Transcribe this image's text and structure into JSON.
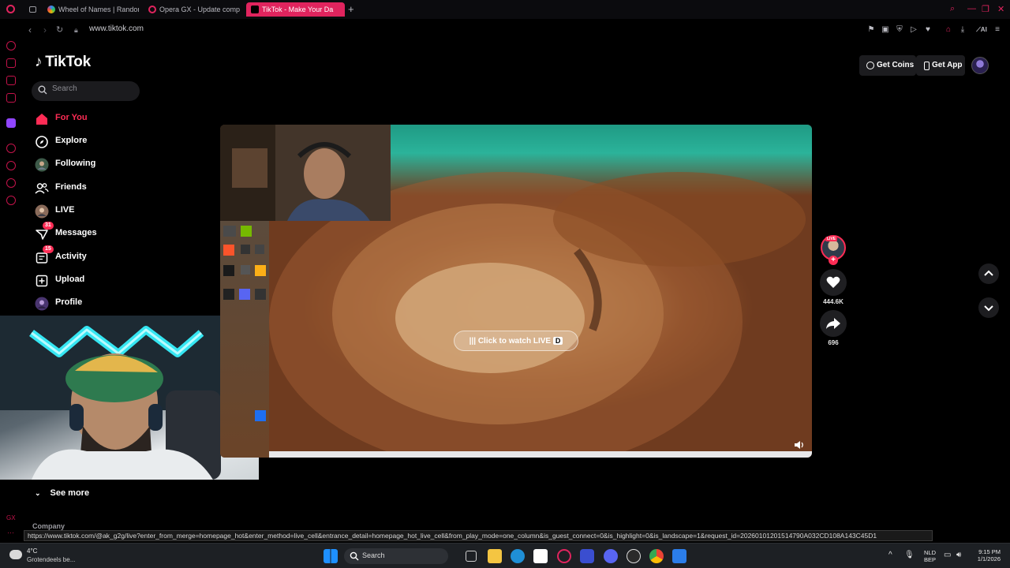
{
  "browser": {
    "tabs": [
      {
        "label": "Wheel of Names | Random",
        "active": false
      },
      {
        "label": "Opera GX - Update comp",
        "active": false
      },
      {
        "label": "TikTok - Make Your Da",
        "active": true
      }
    ],
    "url": "www.tiktok.com",
    "toolbar_ai": "AI",
    "accent": "#e0245e"
  },
  "tiktok": {
    "logo": "TikTok",
    "search_placeholder": "Search",
    "nav": [
      {
        "label": "For You",
        "icon": "home-icon",
        "active": true
      },
      {
        "label": "Explore",
        "icon": "compass-icon"
      },
      {
        "label": "Following",
        "icon": "avatar-icon"
      },
      {
        "label": "Friends",
        "icon": "friends-icon"
      },
      {
        "label": "LIVE",
        "icon": "live-avatar-icon"
      },
      {
        "label": "Messages",
        "icon": "messages-icon",
        "badge": "31"
      },
      {
        "label": "Activity",
        "icon": "activity-icon",
        "badge": "15"
      },
      {
        "label": "Upload",
        "icon": "upload-icon"
      },
      {
        "label": "Profile",
        "icon": "profile-avatar-icon"
      }
    ],
    "see_more": "See more",
    "company": "Company",
    "get_coins": "Get Coins",
    "get_app": "Get App",
    "video": {
      "watch_live": "Click to watch LIVE",
      "live_badge": "LIVE",
      "likes": "444.6K",
      "shares": "696"
    },
    "brand_color": "#fe2c55"
  },
  "status_url": "https://www.tiktok.com/@ak_g2g/live?enter_from_merge=homepage_hot&enter_method=live_cell&entrance_detail=homepage_hot_live_cell&from_play_mode=one_column&is_guest_connect=0&is_highlight=0&is_landscape=1&request_id=20260101201514790A032CD108A143C45D1",
  "taskbar": {
    "weather_temp": "4°C",
    "weather_desc": "Grotendeels be...",
    "search_label": "Search",
    "lang_line1": "NLD",
    "lang_line2": "BEP",
    "time": "9:15 PM",
    "date": "1/1/2026"
  }
}
